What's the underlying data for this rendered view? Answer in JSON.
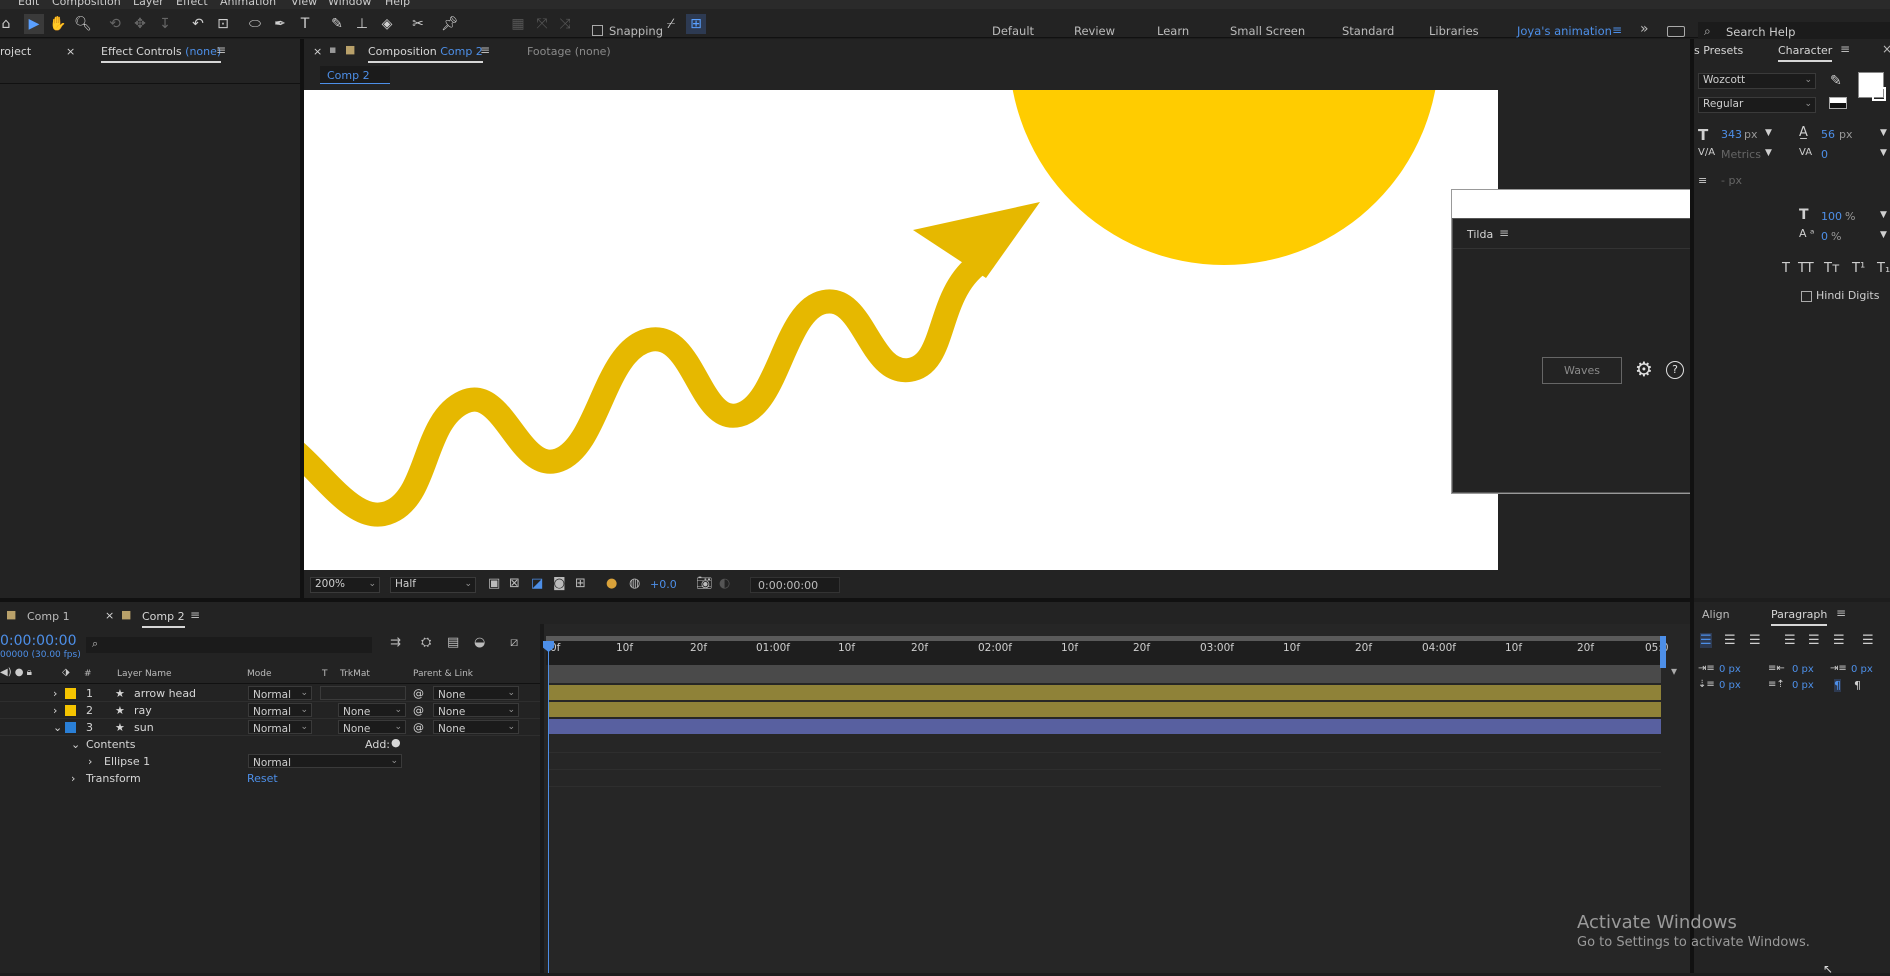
{
  "menu": [
    "Edit",
    "Composition",
    "Layer",
    "Effect",
    "Animation",
    "View",
    "Window",
    "Help"
  ],
  "toolbar": {
    "snapping": "Snapping"
  },
  "workspaces": [
    "Default",
    "Review",
    "Learn",
    "Small Screen",
    "Standard",
    "Libraries"
  ],
  "workspace_active": "Joya's animation",
  "search_help": "Search Help",
  "left_panel": {
    "project_tab": "roject",
    "effect_controls": "Effect Controls",
    "effect_target": "(none)"
  },
  "comp_panel": {
    "tab_prefix": "Composition",
    "tab_name": "Comp 2",
    "footage": "Footage",
    "footage_target": "(none)",
    "breadcrumb": "Comp 2",
    "zoom": "200%",
    "resolution": "Half",
    "exposure": "+0.0",
    "timecode": "0:00:00:00"
  },
  "tilda": {
    "title": "Tilda",
    "button": "Waves"
  },
  "right_panel": {
    "presets_tab": "s Presets",
    "character_tab": "Character",
    "font": "Wozcott",
    "style": "Regular",
    "size": "343",
    "size_unit": "px",
    "leading": "56",
    "leading_unit": "px",
    "kerning": "Metrics",
    "tracking": "0",
    "vscale": "100",
    "vscale_unit": "%",
    "baseline": "0",
    "baseline_unit": "%",
    "px_dash": "- px",
    "hindi": "Hindi Digits",
    "typo": [
      "T",
      "TT",
      "Tт",
      "T¹",
      "T₁"
    ]
  },
  "paragraph_panel": {
    "align_tab": "Align",
    "paragraph_tab": "Paragraph",
    "vals": [
      "0 px",
      "0 px",
      "0 px",
      "0 px",
      "0 px"
    ]
  },
  "timeline": {
    "tabs": [
      "Comp 1",
      "Comp 2"
    ],
    "timecode": "0:00:00:00",
    "fps": "00000 (30.00 fps)",
    "headers": {
      "num": "#",
      "name": "Layer Name",
      "mode": "Mode",
      "t": "T",
      "trkmat": "TrkMat",
      "parent": "Parent & Link"
    },
    "layers": [
      {
        "num": "1",
        "name": "arrow head",
        "mode": "Normal",
        "trkmat": "",
        "parent": "None",
        "color": "#f5c400"
      },
      {
        "num": "2",
        "name": "ray",
        "mode": "Normal",
        "trkmat": "None",
        "parent": "None",
        "color": "#f5c400"
      },
      {
        "num": "3",
        "name": "sun",
        "mode": "Normal",
        "trkmat": "None",
        "parent": "None",
        "color": "#2a7fd6"
      }
    ],
    "contents": "Contents",
    "add": "Add:",
    "ellipse": "Ellipse 1",
    "ellipse_mode": "Normal",
    "transform": "Transform",
    "reset": "Reset",
    "ruler": [
      "0f",
      "10f",
      "20f",
      "01:00f",
      "10f",
      "20f",
      "02:00f",
      "10f",
      "20f",
      "03:00f",
      "10f",
      "20f",
      "04:00f",
      "10f",
      "20f",
      "05:0"
    ]
  },
  "watermark": {
    "title": "Activate Windows",
    "subtitle": "Go to Settings to activate Windows."
  },
  "colors": {
    "accent": "#4d8fe8",
    "sun": "#ffcc00",
    "arrow": "#e6b800",
    "bar_yellow": "#8f8238",
    "bar_blue": "#5860a0"
  }
}
